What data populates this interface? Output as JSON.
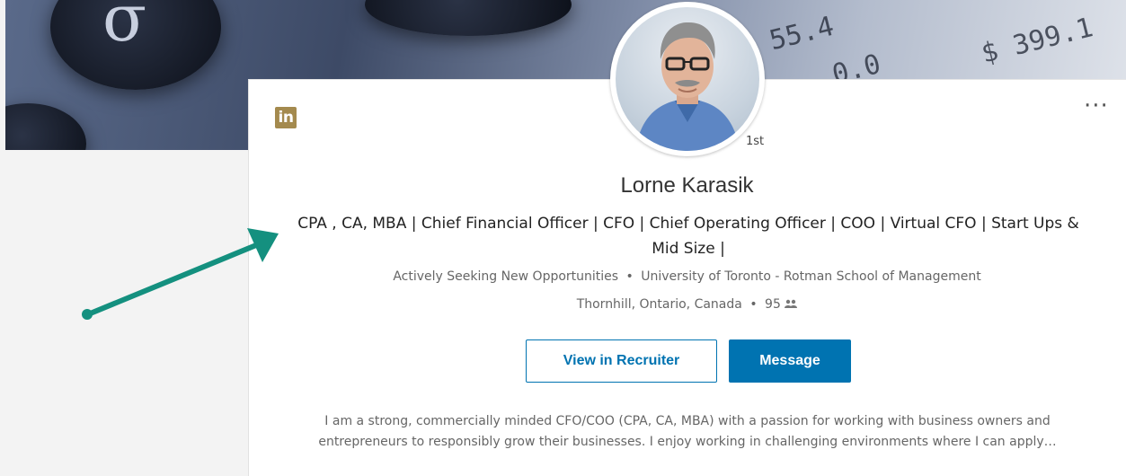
{
  "profile": {
    "name": "Lorne Karasik",
    "degree": "1st",
    "headline_line1": "CPA , CA, MBA | Chief Financial Officer | CFO |  Chief Operating Officer | COO | Virtual CFO | Start Ups &",
    "headline_line2": "Mid Size |",
    "current": "Actively Seeking New Opportunities",
    "education": "University of Toronto - Rotman School of Management",
    "location": "Thornhill, Ontario, Canada",
    "connections": "95",
    "separator": "•",
    "summary_line1": "I am a strong, commercially minded CFO/COO (CPA, CA, MBA) with a passion for working with business owners and",
    "summary_line2": "entrepreneurs to responsibly grow their businesses. I enjoy working in challenging environments where I can apply…"
  },
  "actions": {
    "view_in_recruiter": "View in Recruiter",
    "message": "Message",
    "more": "···"
  },
  "brand": {
    "logo_text": "in",
    "logo_color": "#a48a4e",
    "primary_color": "#0073b1",
    "arrow_color": "#14907f"
  },
  "cover": {
    "key_symbol": "σ",
    "digits": "$ 399.1",
    "digits2": "55.4",
    "digits3": "0.0"
  }
}
